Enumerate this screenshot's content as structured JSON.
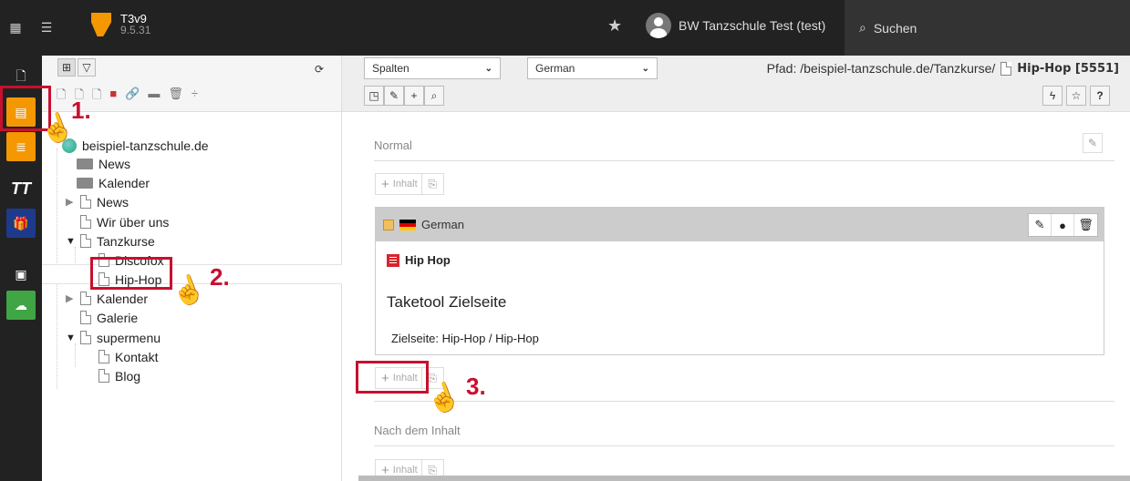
{
  "topbar": {
    "app_name": "T3v9",
    "app_version": "9.5.31",
    "user_name": "BW Tanzschule Test (test)",
    "search_label": "Suchen"
  },
  "tree": {
    "root": "beispiel-tanzschule.de",
    "nodes": [
      {
        "label": "News",
        "type": "folder"
      },
      {
        "label": "Kalender",
        "type": "folder"
      },
      {
        "label": "News",
        "type": "page",
        "toggle": "closed"
      },
      {
        "label": "Wir über uns",
        "type": "page"
      },
      {
        "label": "Tanzkurse",
        "type": "page",
        "toggle": "open"
      },
      {
        "label": "Discofox",
        "type": "page"
      },
      {
        "label": "Hip-Hop",
        "type": "page",
        "selected": true
      },
      {
        "label": "Kalender",
        "type": "page",
        "toggle": "closed"
      },
      {
        "label": "Galerie",
        "type": "page"
      },
      {
        "label": "supermenu",
        "type": "page",
        "toggle": "open"
      },
      {
        "label": "Kontakt",
        "type": "page"
      },
      {
        "label": "Blog",
        "type": "page"
      }
    ]
  },
  "docheader": {
    "view_select": "Spalten",
    "language_select": "German",
    "path_prefix": "Pfad: /beispiel-tanzschule.de/Tanzkurse/",
    "page_title": "Hip-Hop [5551]"
  },
  "content": {
    "col_normal": "Normal",
    "col_after": "Nach dem Inhalt",
    "new_content_label": "Inhalt",
    "card": {
      "language": "German",
      "type_label": "Hip Hop",
      "title": "Taketool Zielseite",
      "target": "Zielseite:  Hip-Hop / Hip-Hop"
    }
  },
  "annotations": {
    "step1": "1.",
    "step2": "2.",
    "step3": "3."
  },
  "colors": {
    "topbar": "#222222",
    "accent_orange": "#f49700",
    "annotation_red": "#c8102e"
  }
}
